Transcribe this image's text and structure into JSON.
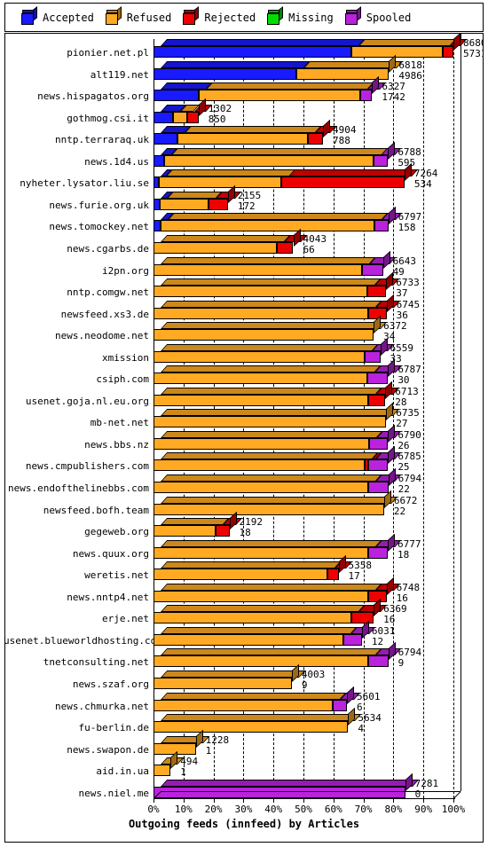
{
  "legend": {
    "items": [
      {
        "label": "Accepted",
        "color": "#1a1aff",
        "icon": "cube-icon"
      },
      {
        "label": "Refused",
        "color": "#ffaa22",
        "icon": "cube-icon"
      },
      {
        "label": "Rejected",
        "color": "#ee0000",
        "icon": "cube-icon"
      },
      {
        "label": "Missing",
        "color": "#00dd00",
        "icon": "cube-icon"
      },
      {
        "label": "Spooled",
        "color": "#bb22dd",
        "icon": "cube-icon"
      }
    ]
  },
  "chart_data": {
    "type": "bar",
    "orientation": "horizontal",
    "stacked": true,
    "title": "Outgoing feeds (innfeed) by Articles",
    "xlabel": "Outgoing feeds (innfeed) by Articles",
    "ylabel": "",
    "xlim": [
      0,
      100
    ],
    "xunit": "%",
    "grid": true,
    "legend_position": "top",
    "xticks": [
      "0%",
      "10%",
      "20%",
      "30%",
      "40%",
      "50%",
      "60%",
      "70%",
      "80%",
      "90%",
      "100%"
    ],
    "xtick_values": [
      0,
      10,
      20,
      30,
      40,
      50,
      60,
      70,
      80,
      90,
      100
    ],
    "series": [
      "Accepted",
      "Refused",
      "Rejected",
      "Missing",
      "Spooled"
    ],
    "categories": [
      "pionier.net.pl",
      "alt119.net",
      "news.hispagatos.org",
      "gothmog.csi.it",
      "nntp.terraraq.uk",
      "news.1d4.us",
      "nyheter.lysator.liu.se",
      "news.furie.org.uk",
      "news.tomockey.net",
      "news.cgarbs.de",
      "i2pn.org",
      "nntp.comgw.net",
      "newsfeed.xs3.de",
      "news.neodome.net",
      "xmission",
      "csiph.com",
      "usenet.goja.nl.eu.org",
      "mb-net.net",
      "news.bbs.nz",
      "news.cmpublishers.com",
      "news.endofthelinebbs.com",
      "newsfeed.bofh.team",
      "gegeweb.org",
      "news.quux.org",
      "weretis.net",
      "news.nntp4.net",
      "erje.net",
      "usenet.blueworldhosting.com",
      "tnetconsulting.net",
      "news.szaf.org",
      "news.chmurka.net",
      "fu-berlin.de",
      "news.swapon.de",
      "aid.in.ua",
      "news.niel.me"
    ],
    "rows": [
      {
        "label": "pionier.net.pl",
        "total": 8680,
        "second": 5731,
        "width_pct": 100.0,
        "parts": [
          {
            "c": "Accepted",
            "p": 66.0
          },
          {
            "c": "Refused",
            "p": 30.5
          },
          {
            "c": "Rejected",
            "p": 3.5
          }
        ]
      },
      {
        "label": "alt119.net",
        "total": 6818,
        "second": 4986,
        "width_pct": 78.5,
        "parts": [
          {
            "c": "Accepted",
            "p": 60.5
          },
          {
            "c": "Refused",
            "p": 39.5
          }
        ]
      },
      {
        "label": "news.hispagatos.org",
        "total": 6327,
        "second": 1742,
        "width_pct": 72.9,
        "parts": [
          {
            "c": "Accepted",
            "p": 20.5
          },
          {
            "c": "Refused",
            "p": 74.0
          },
          {
            "c": "Spooled",
            "p": 5.5
          }
        ]
      },
      {
        "label": "gothmog.csi.it",
        "total": 1302,
        "second": 850,
        "width_pct": 15.0,
        "parts": [
          {
            "c": "Accepted",
            "p": 44.0
          },
          {
            "c": "Refused",
            "p": 30.0
          },
          {
            "c": "Rejected",
            "p": 26.0
          }
        ]
      },
      {
        "label": "nntp.terraraq.uk",
        "total": 4904,
        "second": 788,
        "width_pct": 56.5,
        "parts": [
          {
            "c": "Accepted",
            "p": 14.0
          },
          {
            "c": "Refused",
            "p": 77.0
          },
          {
            "c": "Rejected",
            "p": 9.0
          }
        ]
      },
      {
        "label": "news.1d4.us",
        "total": 6788,
        "second": 595,
        "width_pct": 78.2,
        "parts": [
          {
            "c": "Accepted",
            "p": 4.5
          },
          {
            "c": "Refused",
            "p": 89.5
          },
          {
            "c": "Spooled",
            "p": 6.0
          }
        ]
      },
      {
        "label": "nyheter.lysator.liu.se",
        "total": 7264,
        "second": 534,
        "width_pct": 83.7,
        "parts": [
          {
            "c": "Accepted",
            "p": 2.0
          },
          {
            "c": "Refused",
            "p": 49.0
          },
          {
            "c": "Rejected",
            "p": 49.0
          }
        ]
      },
      {
        "label": "news.furie.org.uk",
        "total": 2155,
        "second": 172,
        "width_pct": 24.8,
        "parts": [
          {
            "c": "Accepted",
            "p": 8.0
          },
          {
            "c": "Refused",
            "p": 66.0
          },
          {
            "c": "Rejected",
            "p": 26.0
          }
        ]
      },
      {
        "label": "news.tomockey.net",
        "total": 6797,
        "second": 158,
        "width_pct": 78.3,
        "parts": [
          {
            "c": "Accepted",
            "p": 3.0
          },
          {
            "c": "Refused",
            "p": 91.0
          },
          {
            "c": "Spooled",
            "p": 6.0
          }
        ]
      },
      {
        "label": "news.cgarbs.de",
        "total": 4043,
        "second": 66,
        "width_pct": 46.6,
        "parts": [
          {
            "c": "Refused",
            "p": 88.0
          },
          {
            "c": "Rejected",
            "p": 12.0
          }
        ]
      },
      {
        "label": "i2pn.org",
        "total": 6643,
        "second": 49,
        "width_pct": 76.5,
        "parts": [
          {
            "c": "Refused",
            "p": 91.0
          },
          {
            "c": "Spooled",
            "p": 9.0
          }
        ]
      },
      {
        "label": "nntp.comgw.net",
        "total": 6733,
        "second": 37,
        "width_pct": 77.6,
        "parts": [
          {
            "c": "Refused",
            "p": 92.0
          },
          {
            "c": "Rejected",
            "p": 8.0
          }
        ]
      },
      {
        "label": "newsfeed.xs3.de",
        "total": 6745,
        "second": 36,
        "width_pct": 77.7,
        "parts": [
          {
            "c": "Refused",
            "p": 92.0
          },
          {
            "c": "Rejected",
            "p": 8.0
          }
        ]
      },
      {
        "label": "news.neodome.net",
        "total": 6372,
        "second": 34,
        "width_pct": 73.4,
        "parts": [
          {
            "c": "Refused",
            "p": 100.0
          }
        ]
      },
      {
        "label": "xmission",
        "total": 6559,
        "second": 33,
        "width_pct": 75.6,
        "parts": [
          {
            "c": "Refused",
            "p": 93.0
          },
          {
            "c": "Spooled",
            "p": 7.0
          }
        ]
      },
      {
        "label": "csiph.com",
        "total": 6787,
        "second": 30,
        "width_pct": 78.2,
        "parts": [
          {
            "c": "Refused",
            "p": 91.0
          },
          {
            "c": "Spooled",
            "p": 9.0
          }
        ]
      },
      {
        "label": "usenet.goja.nl.eu.org",
        "total": 6713,
        "second": 28,
        "width_pct": 77.3,
        "parts": [
          {
            "c": "Refused",
            "p": 92.5
          },
          {
            "c": "Rejected",
            "p": 7.5
          }
        ]
      },
      {
        "label": "mb-net.net",
        "total": 6735,
        "second": 27,
        "width_pct": 77.6,
        "parts": [
          {
            "c": "Refused",
            "p": 100.0
          }
        ]
      },
      {
        "label": "news.bbs.nz",
        "total": 6790,
        "second": 26,
        "width_pct": 78.2,
        "parts": [
          {
            "c": "Refused",
            "p": 92.0
          },
          {
            "c": "Spooled",
            "p": 8.0
          }
        ]
      },
      {
        "label": "news.cmpublishers.com",
        "total": 6785,
        "second": 25,
        "width_pct": 78.2,
        "parts": [
          {
            "c": "Refused",
            "p": 90.0
          },
          {
            "c": "Rejected",
            "p": 1.5
          },
          {
            "c": "Spooled",
            "p": 8.5
          }
        ]
      },
      {
        "label": "news.endofthelinebbs.com",
        "total": 6794,
        "second": 22,
        "width_pct": 78.3,
        "parts": [
          {
            "c": "Refused",
            "p": 91.5
          },
          {
            "c": "Spooled",
            "p": 8.5
          }
        ]
      },
      {
        "label": "newsfeed.bofh.team",
        "total": 6672,
        "second": 22,
        "width_pct": 76.9,
        "parts": [
          {
            "c": "Refused",
            "p": 100.0
          }
        ]
      },
      {
        "label": "gegeweb.org",
        "total": 2192,
        "second": 18,
        "width_pct": 25.3,
        "parts": [
          {
            "c": "Refused",
            "p": 82.0
          },
          {
            "c": "Rejected",
            "p": 18.0
          }
        ]
      },
      {
        "label": "news.quux.org",
        "total": 6777,
        "second": 18,
        "width_pct": 78.1,
        "parts": [
          {
            "c": "Refused",
            "p": 91.5
          },
          {
            "c": "Spooled",
            "p": 8.5
          }
        ]
      },
      {
        "label": "weretis.net",
        "total": 5358,
        "second": 17,
        "width_pct": 61.7,
        "parts": [
          {
            "c": "Refused",
            "p": 94.0
          },
          {
            "c": "Rejected",
            "p": 6.0
          }
        ]
      },
      {
        "label": "news.nntp4.net",
        "total": 6748,
        "second": 16,
        "width_pct": 77.7,
        "parts": [
          {
            "c": "Refused",
            "p": 92.0
          },
          {
            "c": "Rejected",
            "p": 8.0
          }
        ]
      },
      {
        "label": "erje.net",
        "total": 6369,
        "second": 16,
        "width_pct": 73.4,
        "parts": [
          {
            "c": "Refused",
            "p": 90.0
          },
          {
            "c": "Rejected",
            "p": 10.0
          }
        ]
      },
      {
        "label": "usenet.blueworldhosting.com",
        "total": 6031,
        "second": 12,
        "width_pct": 69.5,
        "parts": [
          {
            "c": "Refused",
            "p": 91.0
          },
          {
            "c": "Spooled",
            "p": 9.0
          }
        ]
      },
      {
        "label": "tnetconsulting.net",
        "total": 6794,
        "second": 9,
        "width_pct": 78.3,
        "parts": [
          {
            "c": "Refused",
            "p": 91.5
          },
          {
            "c": "Spooled",
            "p": 8.5
          }
        ]
      },
      {
        "label": "news.szaf.org",
        "total": 4003,
        "second": 9,
        "width_pct": 46.1,
        "parts": [
          {
            "c": "Refused",
            "p": 100.0
          }
        ]
      },
      {
        "label": "news.chmurka.net",
        "total": 5601,
        "second": 6,
        "width_pct": 64.5,
        "parts": [
          {
            "c": "Refused",
            "p": 92.5
          },
          {
            "c": "Spooled",
            "p": 7.5
          }
        ]
      },
      {
        "label": "fu-berlin.de",
        "total": 5634,
        "second": 4,
        "width_pct": 64.9,
        "parts": [
          {
            "c": "Refused",
            "p": 100.0
          }
        ]
      },
      {
        "label": "news.swapon.de",
        "total": 1228,
        "second": 1,
        "width_pct": 14.1,
        "parts": [
          {
            "c": "Refused",
            "p": 100.0
          }
        ]
      },
      {
        "label": "aid.in.ua",
        "total": 494,
        "second": 1,
        "width_pct": 5.7,
        "parts": [
          {
            "c": "Refused",
            "p": 100.0
          }
        ]
      },
      {
        "label": "news.niel.me",
        "total": 7281,
        "second": 0,
        "width_pct": 83.9,
        "parts": [
          {
            "c": "Spooled",
            "p": 100.0
          }
        ]
      }
    ]
  }
}
